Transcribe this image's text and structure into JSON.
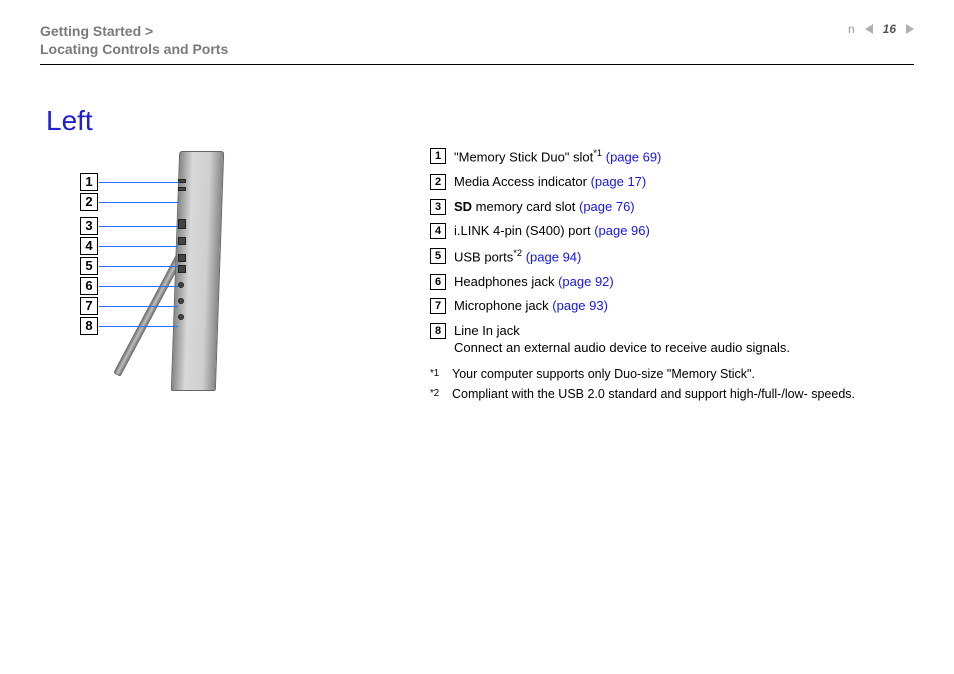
{
  "header": {
    "breadcrumb_l1": "Getting Started >",
    "breadcrumb_l2": "Locating Controls and Ports",
    "page_number": "16",
    "n_label": "n"
  },
  "title": "Left",
  "legend": {
    "items": [
      {
        "num": "1",
        "pre": "\"Memory Stick Duo\" slot",
        "sup": "*1",
        "link": "(page 69)"
      },
      {
        "num": "2",
        "pre": "Media Access indicator ",
        "link": "(page 17)"
      },
      {
        "num": "3",
        "bold": "SD",
        "post": " memory card slot ",
        "link": "(page 76)"
      },
      {
        "num": "4",
        "pre": "i.LINK 4-pin (S400) port ",
        "link": "(page 96)"
      },
      {
        "num": "5",
        "pre": "USB ports",
        "sup": "*2",
        "link": "(page 94)"
      },
      {
        "num": "6",
        "pre": "Headphones jack ",
        "link": "(page 92)"
      },
      {
        "num": "7",
        "pre": "Microphone jack ",
        "link": "(page 93)"
      },
      {
        "num": "8",
        "pre": "Line In jack",
        "desc": "Connect an external audio device to receive audio signals."
      }
    ]
  },
  "footnotes": [
    {
      "mark": "*1",
      "text": "Your computer supports only Duo-size \"Memory Stick\"."
    },
    {
      "mark": "*2",
      "text": "Compliant with the USB 2.0 standard and support high-/full-/low- speeds."
    }
  ],
  "diagram_labels": [
    "1",
    "2",
    "3",
    "4",
    "5",
    "6",
    "7",
    "8"
  ]
}
